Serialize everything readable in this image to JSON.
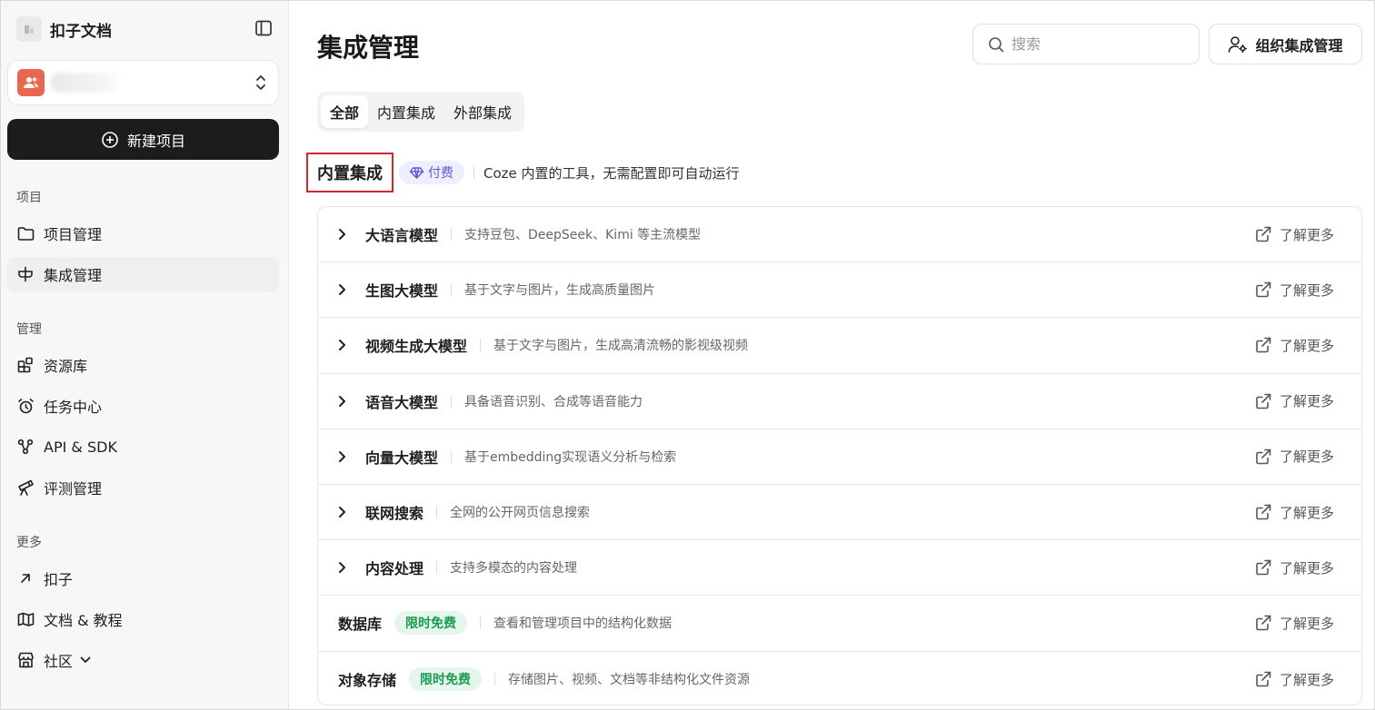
{
  "sidebar": {
    "brand": "扣子文档",
    "new_project": "新建项目",
    "sections": {
      "project": "项目",
      "manage": "管理",
      "more": "更多"
    },
    "items": {
      "project_manage": "项目管理",
      "integration_manage": "集成管理",
      "resource_library": "资源库",
      "task_center": "任务中心",
      "api_sdk": "API & SDK",
      "evaluation": "评测管理",
      "coze": "扣子",
      "docs": "文档 & 教程",
      "community": "社区"
    }
  },
  "main": {
    "title": "集成管理",
    "search_placeholder": "搜索",
    "org_button": "组织集成管理",
    "tabs": [
      "全部",
      "内置集成",
      "外部集成"
    ],
    "section": {
      "title": "内置集成",
      "badge": "付费",
      "desc": "Coze 内置的工具，无需配置即可自动运行"
    },
    "learn_more": "了解更多",
    "rows": [
      {
        "name": "大语言模型",
        "desc": "支持豆包、DeepSeek、Kimi 等主流模型"
      },
      {
        "name": "生图大模型",
        "desc": "基于文字与图片，生成高质量图片"
      },
      {
        "name": "视频生成大模型",
        "desc": "基于文字与图片，生成高清流畅的影视级视频"
      },
      {
        "name": "语音大模型",
        "desc": "具备语音识别、合成等语音能力"
      },
      {
        "name": "向量大模型",
        "desc": "基于embedding实现语义分析与检索"
      },
      {
        "name": "联网搜索",
        "desc": "全网的公开网页信息搜索"
      },
      {
        "name": "内容处理",
        "desc": "支持多模态的内容处理"
      },
      {
        "name": "数据库",
        "badge": "限时免费",
        "desc": "查看和管理项目中的结构化数据"
      },
      {
        "name": "对象存储",
        "badge": "限时免费",
        "desc": "存储图片、视频、文档等非结构化文件资源"
      }
    ]
  },
  "colors": {
    "accent_dark": "#1c1c1c",
    "highlight_border": "#d4262c",
    "paid_badge_bg": "#eeeefe",
    "paid_badge_text": "#5b5bd6",
    "free_badge_bg": "#e5f7ec",
    "free_badge_text": "#1a9a52",
    "workspace_avatar": "#e8684f"
  }
}
